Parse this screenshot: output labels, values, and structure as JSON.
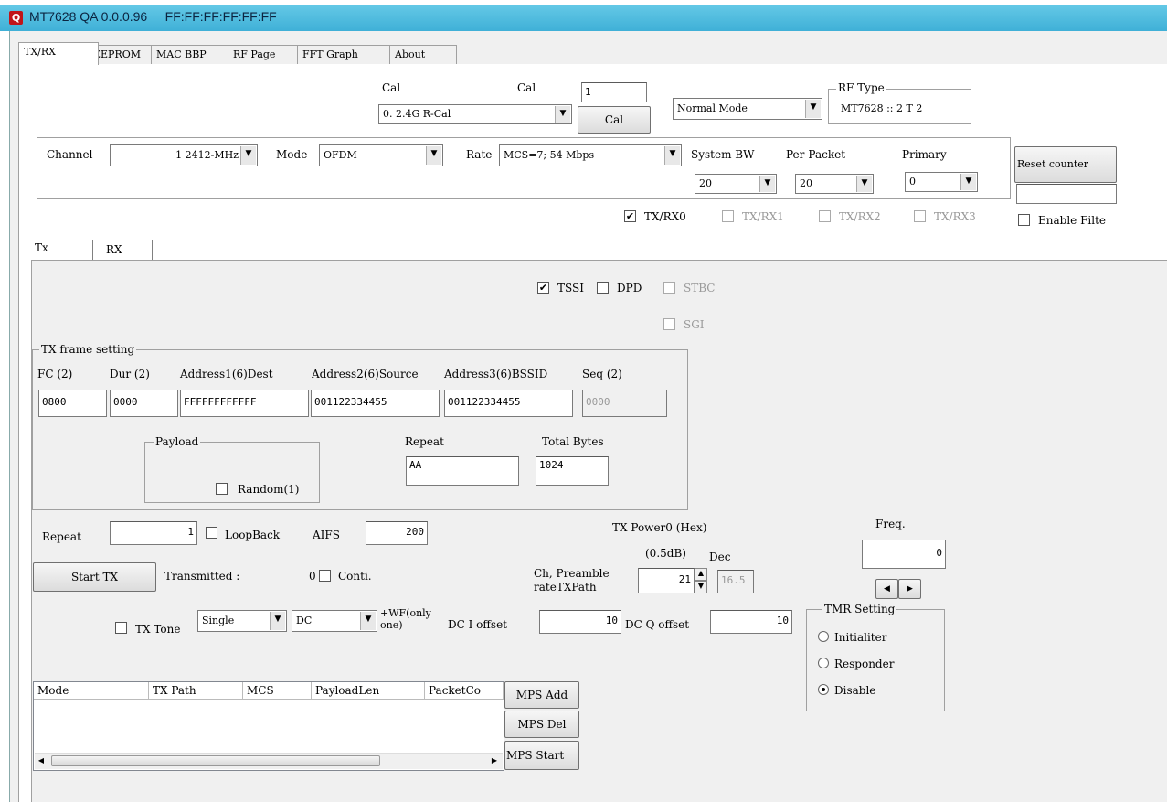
{
  "window": {
    "title": "MT7628 QA 0.0.0.96",
    "mac": "FF:FF:FF:FF:FF:FF",
    "icon": "Q"
  },
  "main_tabs": [
    "TX/RX",
    "EEPROM",
    "MAC  BBP",
    "RF Page",
    "FFT Graph",
    "About"
  ],
  "cal": {
    "label1": "Cal",
    "label2": "Cal",
    "select_value": "0. 2.4G R-Cal",
    "input_value": "1",
    "button": "Cal",
    "mode_select": "Normal Mode",
    "rf_type_title": "RF Type",
    "rf_type_value": "MT7628 :: 2 T 2"
  },
  "channel_group": {
    "channel_label": "Channel",
    "channel_value": "1  2412-MHz",
    "mode_label": "Mode",
    "mode_value": "OFDM",
    "rate_label": "Rate",
    "rate_value": "MCS=7; 54 Mbps",
    "system_bw_label": "System BW",
    "system_bw_value": "20",
    "per_packet_label": "Per-Packet",
    "per_packet_value": "20",
    "primary_label": "Primary",
    "primary_value": "0"
  },
  "reset_counter": {
    "button": "Reset counter",
    "value": ""
  },
  "txrx_checks": [
    {
      "label": "TX/RX0",
      "checked": true,
      "enabled": true
    },
    {
      "label": "TX/RX1",
      "checked": false,
      "enabled": false
    },
    {
      "label": "TX/RX2",
      "checked": false,
      "enabled": false
    },
    {
      "label": "TX/RX3",
      "checked": false,
      "enabled": false
    }
  ],
  "enable_filter": "Enable Filte",
  "sub_tabs": [
    "Tx",
    "RX"
  ],
  "options": {
    "tssi": "TSSI",
    "dpd": "DPD",
    "stbc": "STBC",
    "sgi": "SGI"
  },
  "frame": {
    "title": "TX frame setting",
    "labels": [
      "FC (2)",
      "Dur (2)",
      "Address1(6)Dest",
      "Address2(6)Source",
      "Address3(6)BSSID",
      "Seq (2)"
    ],
    "values": [
      "0800",
      "0000",
      "FFFFFFFFFFFF",
      "001122334455",
      "001122334455",
      "0000"
    ],
    "payload_title": "Payload",
    "random_label": "Random(1)",
    "repeat_label": "Repeat",
    "repeat_value": "AA",
    "total_bytes_label": "Total Bytes",
    "total_bytes_value": "1024"
  },
  "tx_controls": {
    "repeat_label": "Repeat",
    "repeat_value": "1",
    "loopback_label": "LoopBack",
    "aifs_label": "AIFS",
    "aifs_value": "200",
    "start_tx": "Start TX",
    "transmitted_label": "Transmitted :",
    "transmitted_value": "0",
    "conti_label": "Conti.",
    "tx_power_label": "TX Power0 (Hex)",
    "tx_power_unit": "(0.5dB)",
    "dec_label": "Dec",
    "ch_preamble_label1": "Ch, Preamble",
    "ch_preamble_label2": "rateTXPath",
    "tx_power_value": "21",
    "dec_value": "16.5",
    "freq_label": "Freq.",
    "freq_value": "0",
    "tx_tone_label": "TX Tone",
    "tone_select": "Single",
    "dc_select": "DC",
    "wf_note1": "+WF(only",
    "wf_note2": "one)",
    "dc_i_label": "DC I offset",
    "dc_i_value": "10",
    "dc_q_label": "DC Q offset",
    "dc_q_value": "10"
  },
  "tmr": {
    "title": "TMR Setting",
    "options": [
      "Initialiter",
      "Responder",
      "Disable"
    ],
    "selected": 2
  },
  "mps": {
    "columns": [
      "Mode",
      "TX Path",
      "MCS",
      "PayloadLen",
      "PacketCo"
    ],
    "add": "MPS Add",
    "del": "MPS Del",
    "start": "MPS Start"
  }
}
